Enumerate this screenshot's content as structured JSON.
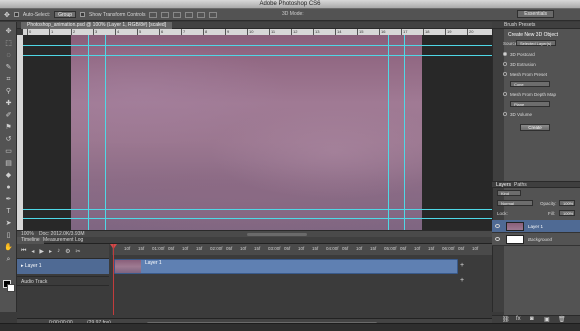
{
  "window": {
    "title": "Adobe Photoshop CS6"
  },
  "options_bar": {
    "auto_select_label": "Auto-Select:",
    "auto_select_value": "Group",
    "transform_label": "Show Transform Controls",
    "mode_3d_label": "3D Mode:",
    "workspace": "Essentials"
  },
  "document": {
    "tab_title": "Photoshop_animation.psd @ 100% (Layer 1, RGB/8#) [scaled]",
    "zoom": "100%",
    "doc_info": "Doc: 2012.0K/3.93M",
    "ruler_numbers": [
      "0",
      "1",
      "2",
      "3",
      "4",
      "5",
      "6",
      "7",
      "8",
      "9",
      "10",
      "11",
      "12",
      "13",
      "14",
      "15",
      "16",
      "17",
      "18",
      "19",
      "20"
    ]
  },
  "timeline": {
    "tabs": [
      "Timeline",
      "Measurement Log"
    ],
    "ticks": [
      "10f",
      "15f",
      "01:00f",
      "05f",
      "10f",
      "15f",
      "02:00f",
      "05f",
      "10f",
      "15f",
      "03:00f",
      "05f",
      "10f",
      "15f",
      "04:00f",
      "05f",
      "10f",
      "15f",
      "05:00f",
      "05f",
      "10f",
      "15f",
      "06:00f",
      "05f",
      "10f",
      "15f"
    ],
    "tracks": [
      {
        "label": "Layer 1",
        "clip_label": "Layer 1"
      },
      {
        "label": "Audio Track"
      }
    ],
    "current_time": "0;00;00;00",
    "fps": "(29.97 fps)"
  },
  "properties_panel": {
    "header": "Brush Presets",
    "title": "Create New 3D Object",
    "source_label": "Source:",
    "source_value": "Selected Layer(s)",
    "options": [
      {
        "label": "3D Postcard",
        "selected": true
      },
      {
        "label": "3D Extrusion",
        "selected": false
      },
      {
        "label": "Mesh From Preset",
        "selected": false
      },
      {
        "label": "Mesh From Depth Map",
        "selected": false
      },
      {
        "label": "3D Volume",
        "selected": false
      }
    ],
    "preset_value": "Cone",
    "depth_value": "Plane",
    "create_label": "Create"
  },
  "layers_panel": {
    "tabs": [
      "Layers",
      "Paths"
    ],
    "kind": "Kind",
    "blend_mode": "Normal",
    "opacity_label": "Opacity:",
    "opacity_value": "100%",
    "lock_label": "Lock:",
    "fill_label": "Fill:",
    "fill_value": "100%",
    "layers": [
      {
        "name": "Layer 1",
        "active": true
      },
      {
        "name": "Background",
        "active": false
      }
    ]
  },
  "colors": {
    "guide": "#4fd8e6",
    "clip": "#5f80b2",
    "selected_row": "#4f6a94",
    "playhead": "#c23c3c"
  }
}
